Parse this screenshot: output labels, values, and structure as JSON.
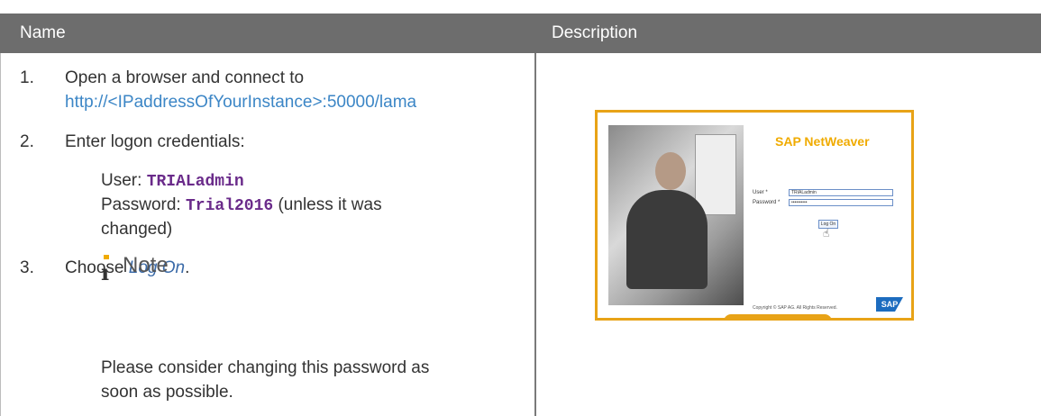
{
  "table": {
    "header_name": "Name",
    "header_description": "Description"
  },
  "steps": {
    "s1_num": "1.",
    "s1_text": "Open a browser and connect to",
    "s1_link": "http://<IPaddressOfYourInstance>:50000/lama",
    "s2_num": "2.",
    "s2_text": "Enter logon credentials:",
    "user_label": "User: ",
    "user_value": "TRIALadmin",
    "password_label": "Password: ",
    "password_value": "Trial2016",
    "password_suffix": " (unless it was",
    "password_suffix2": "changed)",
    "s3_num": "3.",
    "s3_prefix": "Choose ",
    "s3_action": "Log On",
    "s3_suffix": "."
  },
  "note": {
    "icon": "info-icon",
    "label": "Note",
    "line1": "Please consider changing this password as",
    "line2": "soon as possible."
  },
  "screenshot": {
    "brand": "SAP NetWeaver",
    "user_label": "User *",
    "user_value": "TRIALadmin",
    "password_label": "Password *",
    "password_value": "••••••••••",
    "button_label": "Log On",
    "copyright": "Copyright © SAP AG. All Rights Reserved.",
    "logo_text": "SAP"
  },
  "colors": {
    "header_bg": "#6d6d6d",
    "link": "#3c86c6",
    "code": "#6a2b8a",
    "accent": "#f0ab00"
  }
}
